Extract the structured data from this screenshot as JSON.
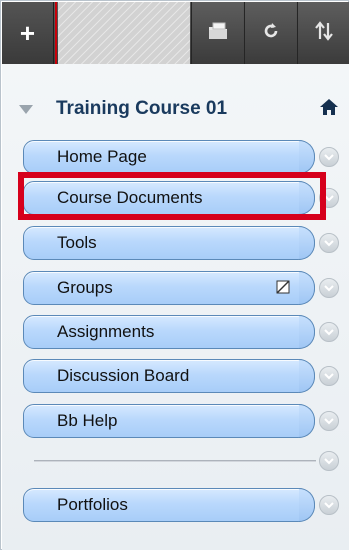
{
  "toolbar": {
    "add_label": "+",
    "buttons": [
      {
        "name": "folder-icon"
      },
      {
        "name": "refresh-icon"
      },
      {
        "name": "sort-icon"
      }
    ]
  },
  "course": {
    "title": "Training Course 01"
  },
  "menu": {
    "items": [
      {
        "label": "Home Page"
      },
      {
        "label": "Course Documents",
        "highlighted": true
      },
      {
        "label": "Tools"
      },
      {
        "label": "Groups",
        "hidden_from_students": true
      },
      {
        "label": "Assignments"
      },
      {
        "label": "Discussion Board"
      },
      {
        "label": "Bb Help"
      },
      {
        "label": "Portfolios"
      }
    ]
  },
  "colors": {
    "item_fill": "#b9d8fc",
    "item_border": "#5b89b8",
    "highlight": "#d6001c",
    "title": "#1a3a5e",
    "toolbar": "#4a4a4a"
  }
}
